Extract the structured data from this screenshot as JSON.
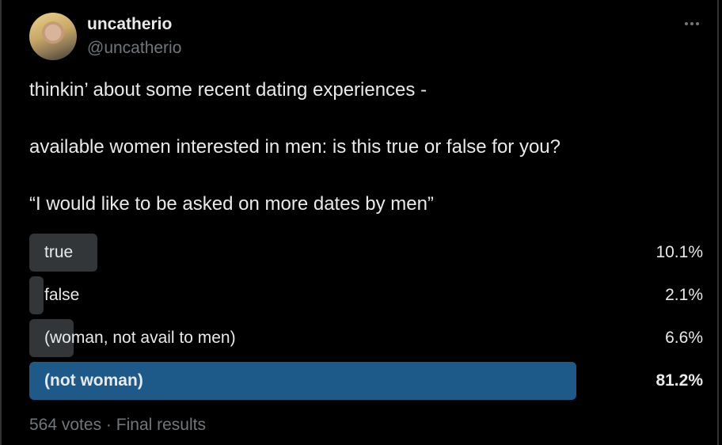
{
  "author": {
    "display_name": "uncatherio",
    "handle": "@uncatherio"
  },
  "more_icon": "more-horizontal-icon",
  "tweet": {
    "line1": "thinkin’ about some recent dating experiences -",
    "line2": "available women interested in men: is this true or false for you?",
    "line3": "“I would like to be asked on more dates by men”"
  },
  "poll": {
    "options": [
      {
        "label": "true",
        "percent_text": "10.1%",
        "percent": 10.1
      },
      {
        "label": "false",
        "percent_text": "2.1%",
        "percent": 2.1
      },
      {
        "label": "(woman, not avail to men)",
        "percent_text": "6.6%",
        "percent": 6.6
      },
      {
        "label": "(not woman)",
        "percent_text": "81.2%",
        "percent": 81.2
      }
    ],
    "votes": "564 votes",
    "separator": "·",
    "status": "Final results"
  },
  "colors": {
    "background": "#000000",
    "bar": "#333639",
    "winner_bar": "#1d5a8a",
    "muted_text": "#71767b"
  }
}
